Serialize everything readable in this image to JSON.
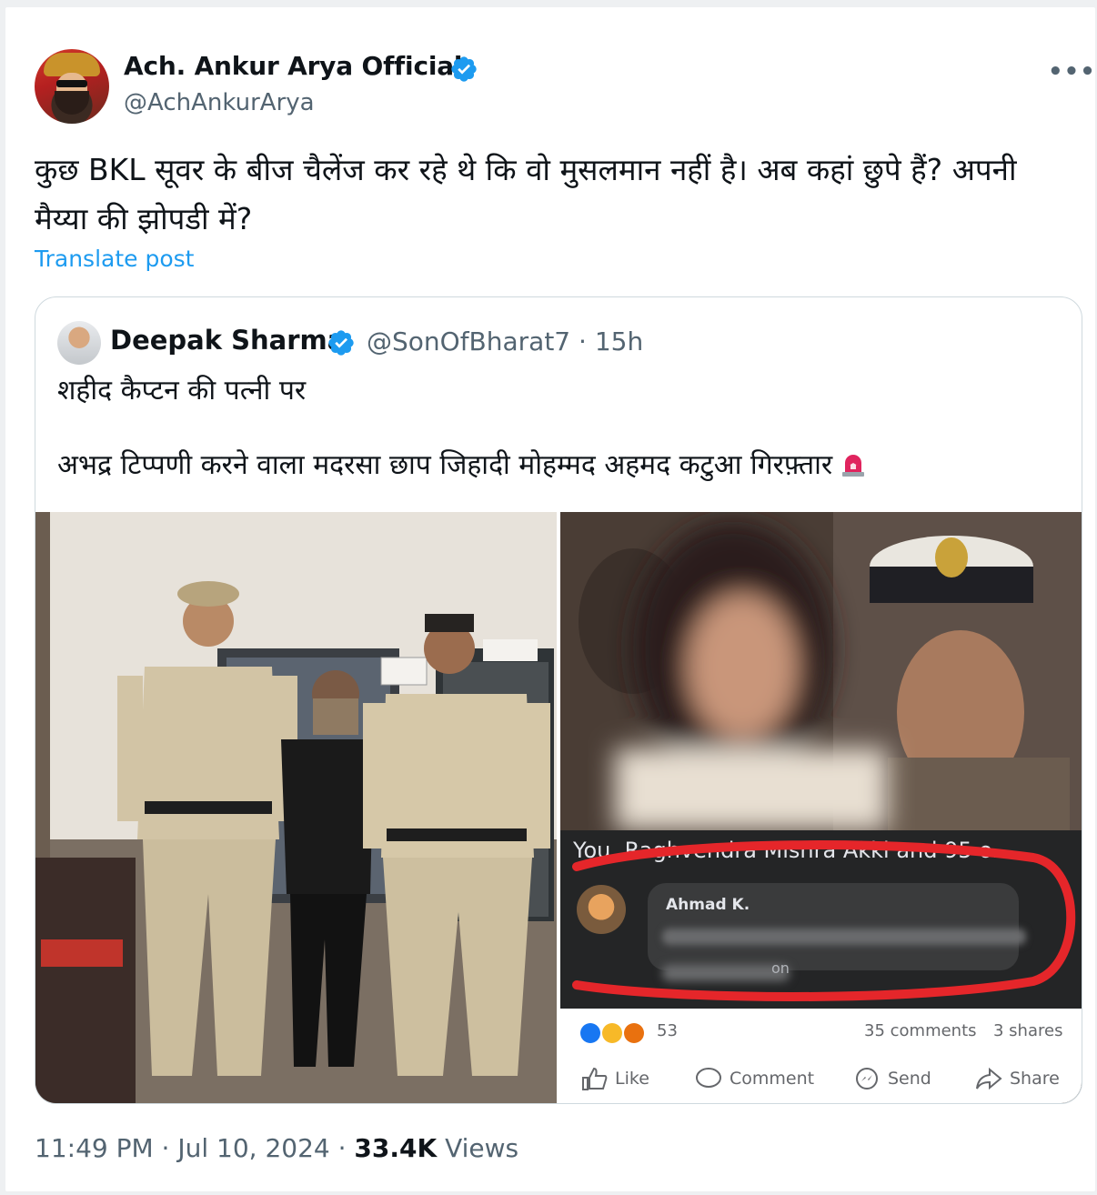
{
  "author": {
    "name": "Ach. Ankur Arya Official",
    "handle": "@AchAnkurArya"
  },
  "post": {
    "text": "कुछ BKL सूवर के बीज चैलेंज कर रहे थे कि वो मुसलमान नहीं है। अब कहां छुपे हैं? अपनी मैय्या की झोपडी में?",
    "translate_label": "Translate post"
  },
  "quote": {
    "name": "Deepak Sharma",
    "handle_time": "@SonOfBharat7 · 15h",
    "line1": "शहीद कैप्टन की पत्नी पर",
    "line2": "अभद्र टिप्पणी करने वाला मदरसा छाप जिहादी मोहम्मद अहमद कटुआ गिरफ़्तार"
  },
  "fb_screenshot": {
    "reactions_line": "You, Raghvendra Mishra Akki and 95 o...",
    "commenter": "Ahmad K.",
    "comment_meta": "on",
    "reaction_count": "53",
    "comments": "35 comments",
    "shares": "3 shares",
    "actions": [
      "Like",
      "Comment",
      "Send",
      "Share"
    ]
  },
  "meta": {
    "time_date": "11:49 PM · Jul 10, 2024 · ",
    "views_count": "33.4K",
    "views_label": " Views"
  },
  "colors": {
    "link": "#1d9bf0",
    "secondary_text": "#536471",
    "verified": "#1d9bf0"
  }
}
